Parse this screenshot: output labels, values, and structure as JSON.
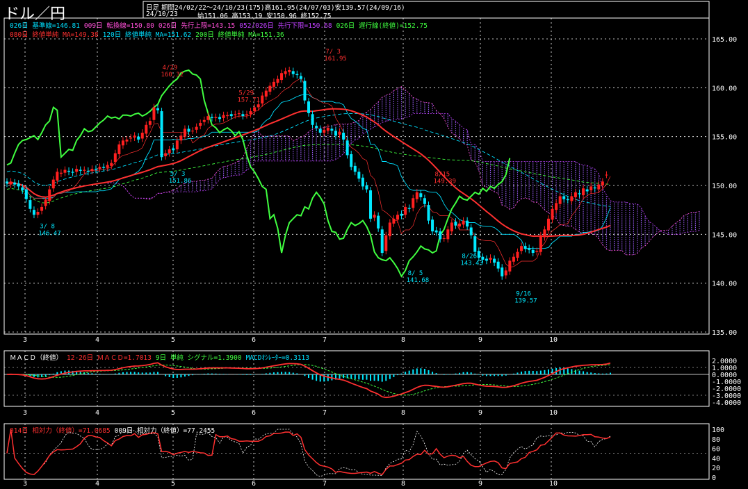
{
  "app": {
    "title": "ドル／円",
    "timeframe": "日足",
    "period_line": "期間24/02/22～24/10/23(175)高161.95(24/07/03)安139.57(24/09/16)",
    "last_date": "24/10/23",
    "ohlc_line": "始151.06 高153.19 安150.96 終152.75"
  },
  "legend": {
    "row1": [
      {
        "text": "026日 基準線=146.81",
        "color": "#00e0ff"
      },
      {
        "text": "009日 転換線=150.80",
        "color": "#ff4fd8"
      },
      {
        "text": "026日 先行上限=143.15",
        "color": "#ff4fd8"
      },
      {
        "text": "052/026日 先行下限=150.68",
        "color": "#c040ff"
      },
      {
        "text": "026日 遅行線(終値)=152.75",
        "color": "#40ff40"
      }
    ],
    "row2": [
      {
        "text": "080日 終値単純 MA=149.38",
        "color": "#ff3030"
      },
      {
        "text": "120日 終値単純 MA=151.62",
        "color": "#00e0ff"
      },
      {
        "text": "200日 終値単純 MA=151.36",
        "color": "#40ff40"
      }
    ],
    "macd": [
      {
        "text": "ＭＡＣＤ（終値）",
        "color": "#ffffff"
      },
      {
        "text": "12-26日 ＭＡＣＤ=1.7013",
        "color": "#ff3030"
      },
      {
        "text": "9日 単純 シグナル=1.3900",
        "color": "#40ff40"
      },
      {
        "text": "MACDｵｼﾚｰﾀｰ=0.3113",
        "color": "#00e0ff"
      }
    ],
    "rsi": [
      {
        "text": "014日 相対力（終値）=71.0685",
        "color": "#ff3030"
      },
      {
        "text": "009日 相対力（終値）=77.2455",
        "color": "#ffffff"
      }
    ]
  },
  "colors": {
    "up": "#ff2020",
    "down": "#00e8ff",
    "grid": "#ffffff",
    "kijun": "#00e0ff",
    "tenkan": "#ff4fd8",
    "chikou": "#40ff40",
    "ma80": "#ff3030",
    "ma120": "#00e0ff",
    "ma200": "#40ff40",
    "cloud": "#a060ff"
  },
  "chart_data": [
    {
      "type": "candlestick",
      "ylim": [
        135,
        165
      ],
      "yticks": [
        "165.00",
        "160.00",
        "155.00",
        "150.00",
        "145.00",
        "140.00",
        "135.00"
      ],
      "month_labels": [
        "3",
        "4",
        "5",
        "6",
        "7",
        "8",
        "9",
        "10"
      ],
      "annotations": [
        {
          "label": "4/29",
          "value": "160.32",
          "x_month": 4.95
        },
        {
          "label": "5/ 3",
          "value": "151.86",
          "x_month": 5.05
        },
        {
          "label": "5/29",
          "value": "157.71",
          "x_month": 5.9
        },
        {
          "label": "7/ 3",
          "value": "161.95",
          "x_month": 7.1
        },
        {
          "label": "3/ 8",
          "value": "146.47",
          "x_month": 3.3
        },
        {
          "label": "8/ 5",
          "value": "141.68",
          "x_month": 8.15
        },
        {
          "label": "8/15",
          "value": "149.39",
          "x_month": 8.5
        },
        {
          "label": "8/26",
          "value": "143.43",
          "x_month": 8.85
        },
        {
          "label": "9/16",
          "value": "139.57",
          "x_month": 9.6
        }
      ],
      "close": [
        150.2,
        150.4,
        150.1,
        149.9,
        149.5,
        148.6,
        147.6,
        147.0,
        147.3,
        147.8,
        148.5,
        149.6,
        150.6,
        151.4,
        151.3,
        151.6,
        151.4,
        151.3,
        151.7,
        151.5,
        151.6,
        151.4,
        151.7,
        151.6,
        151.9,
        151.8,
        152.1,
        152.3,
        153.3,
        154.2,
        154.6,
        154.7,
        154.9,
        155.1,
        154.7,
        155.4,
        156.2,
        156.6,
        158.0,
        157.7,
        152.9,
        153.3,
        153.7,
        153.6,
        154.6,
        155.1,
        155.8,
        155.5,
        155.6,
        156.0,
        156.4,
        156.7,
        157.1,
        156.9,
        157.0,
        156.8,
        157.2,
        157.2,
        157.1,
        157.3,
        157.4,
        157.1,
        157.3,
        157.6,
        158.0,
        158.3,
        159.2,
        159.7,
        160.2,
        160.6,
        160.9,
        161.5,
        161.7,
        161.8,
        161.4,
        161.3,
        160.9,
        158.7,
        157.4,
        156.2,
        155.9,
        155.4,
        155.7,
        155.9,
        155.6,
        155.1,
        155.5,
        154.7,
        153.1,
        151.9,
        151.4,
        150.7,
        149.9,
        149.6,
        146.6,
        147.0,
        145.6,
        143.1,
        144.9,
        146.2,
        146.6,
        147.0,
        146.9,
        147.8,
        147.6,
        148.7,
        149.3,
        148.8,
        148.1,
        146.4,
        145.3,
        145.2,
        144.5,
        144.6,
        145.5,
        146.2,
        145.9,
        146.1,
        146.4,
        145.8,
        144.9,
        143.2,
        142.6,
        142.4,
        142.3,
        142.6,
        142.1,
        141.5,
        140.7,
        141.3,
        142.3,
        142.7,
        143.2,
        143.8,
        143.5,
        143.4,
        143.1,
        143.3,
        144.9,
        145.5,
        146.6,
        147.6,
        148.2,
        148.9,
        148.6,
        148.5,
        148.9,
        149.3,
        149.1,
        149.7,
        149.4,
        149.9,
        149.7,
        150.1,
        150.4,
        151.1,
        152.8
      ],
      "open": [
        150.4,
        150.1,
        150.3,
        150.2,
        149.8,
        149.6,
        148.5,
        147.5,
        147.0,
        147.4,
        147.9,
        148.4,
        149.7,
        150.5,
        151.2,
        151.3,
        151.5,
        151.4,
        151.4,
        151.6,
        151.5,
        151.5,
        151.5,
        151.7,
        151.7,
        151.9,
        151.8,
        152.0,
        152.4,
        153.2,
        154.1,
        154.5,
        154.8,
        154.9,
        155.0,
        154.8,
        155.3,
        156.2,
        156.7,
        157.9,
        157.6,
        153.0,
        153.3,
        153.8,
        153.7,
        154.6,
        155.0,
        155.8,
        155.6,
        155.7,
        156.1,
        156.5,
        156.7,
        157.0,
        156.9,
        157.0,
        156.9,
        157.1,
        157.3,
        157.2,
        157.3,
        157.3,
        157.2,
        157.3,
        157.6,
        158.0,
        158.4,
        159.1,
        159.6,
        160.1,
        160.5,
        160.8,
        161.4,
        161.6,
        161.7,
        161.4,
        161.2,
        160.7,
        158.6,
        157.3,
        156.1,
        155.8,
        155.4,
        155.6,
        155.8,
        155.6,
        155.2,
        155.4,
        154.6,
        153.2,
        152.0,
        151.4,
        150.8,
        150.0,
        149.5,
        146.7,
        146.9,
        145.5,
        143.3,
        144.8,
        146.1,
        146.5,
        147.1,
        147.0,
        147.7,
        147.7,
        148.6,
        149.2,
        148.7,
        148.0,
        146.5,
        145.4,
        145.3,
        144.6,
        144.5,
        145.3,
        146.3,
        145.8,
        146.0,
        146.4,
        145.7,
        144.8,
        143.3,
        142.7,
        142.5,
        142.4,
        142.5,
        142.2,
        141.6,
        140.8,
        141.2,
        142.2,
        142.6,
        143.3,
        143.8,
        143.6,
        143.4,
        143.2,
        143.2,
        144.7,
        145.4,
        146.5,
        147.5,
        148.1,
        148.9,
        148.6,
        148.4,
        148.8,
        149.2,
        149.0,
        149.6,
        149.5,
        149.8,
        149.6,
        150.0,
        151.1
      ]
    },
    {
      "type": "line",
      "name_ref": "macd",
      "ylim": [
        -4.2,
        2.4
      ],
      "yticks": [
        "2.0000",
        "1.0000",
        "0.0000",
        "-1.0000",
        "-2.0000",
        "-3.0000",
        "-4.0000"
      ]
    },
    {
      "type": "line",
      "name_ref": "rsi",
      "ylim": [
        0,
        100
      ],
      "yticks": [
        "100",
        "80",
        "60",
        "40",
        "20",
        "0"
      ]
    }
  ]
}
